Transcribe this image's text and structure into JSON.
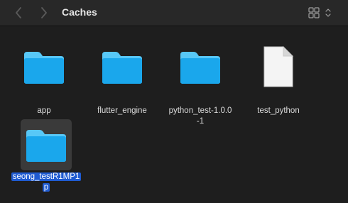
{
  "window": {
    "title": "Caches"
  },
  "toolbar": {
    "back_icon": "chevron-left-icon",
    "forward_icon": "chevron-right-icon",
    "view_icon": "grid-view-icon"
  },
  "items": [
    {
      "name": "app",
      "kind": "folder"
    },
    {
      "name": "flutter_engine",
      "kind": "folder"
    },
    {
      "name_line1": "python_test-1.0.0",
      "name_line2": "-1",
      "kind": "folder"
    },
    {
      "name": "test_python",
      "kind": "document"
    },
    {
      "name_line1": "seong_testR1MP1",
      "name_line2": "p",
      "kind": "folder",
      "selected": true
    }
  ],
  "colors": {
    "folder_top": "#58c8f7",
    "folder_body": "#1aa7ec",
    "selection": "#1f5bd1"
  }
}
